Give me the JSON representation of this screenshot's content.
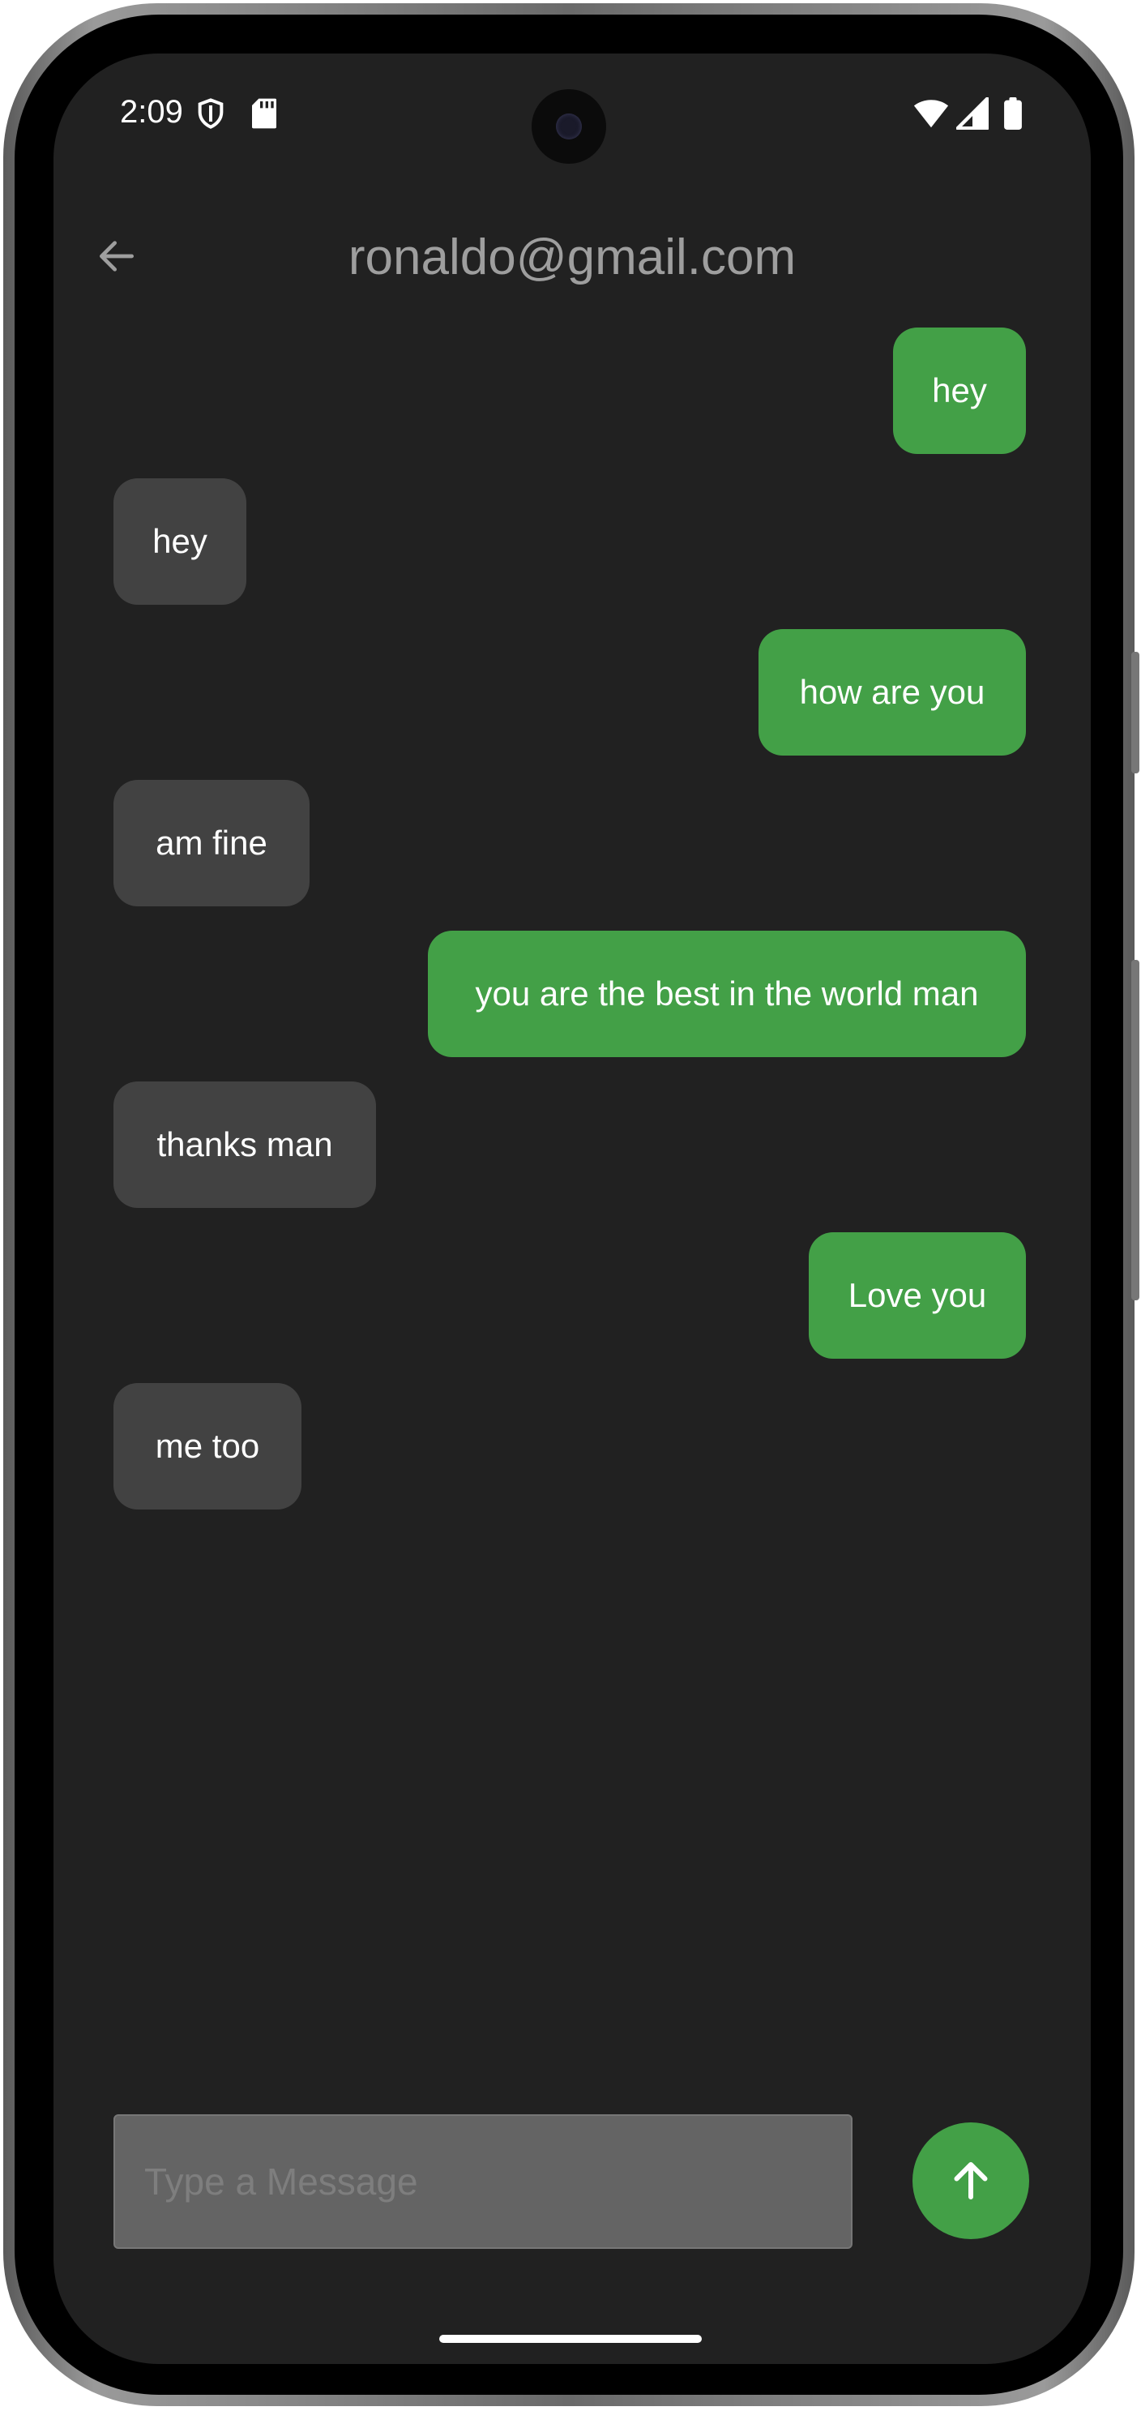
{
  "status_bar": {
    "time": "2:09",
    "icons": [
      "shield-icon",
      "sd-card-icon",
      "wifi-icon",
      "signal-icon",
      "battery-icon"
    ]
  },
  "app_bar": {
    "back_icon": "arrow-left-icon",
    "title": "ronaldo@gmail.com"
  },
  "messages": [
    {
      "text": "hey",
      "direction": "sent"
    },
    {
      "text": "hey",
      "direction": "received"
    },
    {
      "text": "how are you",
      "direction": "sent"
    },
    {
      "text": "am fine",
      "direction": "received"
    },
    {
      "text": "you are the best in the world man",
      "direction": "sent"
    },
    {
      "text": "thanks man",
      "direction": "received"
    },
    {
      "text": "Love you",
      "direction": "sent"
    },
    {
      "text": "me too",
      "direction": "received"
    }
  ],
  "composer": {
    "placeholder": "Type a Message",
    "value": "",
    "send_icon": "arrow-up-icon"
  },
  "colors": {
    "background": "#212121",
    "sent_bubble": "#43a047",
    "received_bubble": "#424242",
    "title_text": "#9e9e9e",
    "input_background": "#646464"
  }
}
